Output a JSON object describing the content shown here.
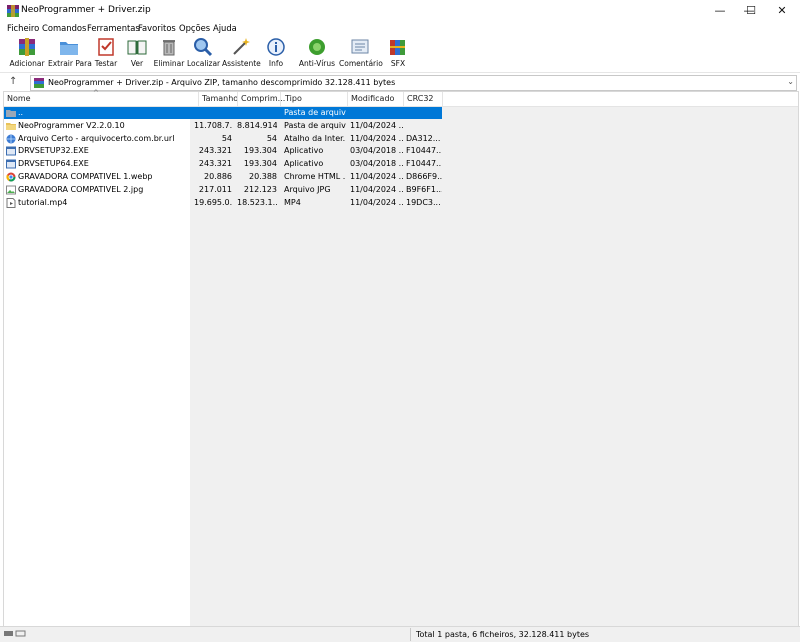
{
  "window": {
    "title": "NeoProgrammer + Driver.zip",
    "minimize": "—",
    "maximize": "☐",
    "close": "✕"
  },
  "menu": [
    "Ficheiro",
    "Comandos",
    "Ferramentas",
    "Favoritos",
    "Opções",
    "Ajuda"
  ],
  "toolbar": [
    {
      "label": "Adicionar",
      "icon": "add-archive-icon"
    },
    {
      "label": "Extrair Para",
      "icon": "extract-folder-icon"
    },
    {
      "label": "Testar",
      "icon": "test-checklist-icon"
    },
    {
      "label": "Ver",
      "icon": "view-book-icon"
    },
    {
      "label": "Eliminar",
      "icon": "trash-icon"
    },
    {
      "label": "Localizar",
      "icon": "magnifier-icon"
    },
    {
      "label": "Assistente",
      "icon": "wizard-wand-icon"
    },
    {
      "label": "Info",
      "icon": "info-icon"
    },
    {
      "label": "Anti-Vírus",
      "icon": "antivirus-bug-icon"
    },
    {
      "label": "Comentário",
      "icon": "comment-icon"
    },
    {
      "label": "SFX",
      "icon": "sfx-books-icon"
    }
  ],
  "address": {
    "up": "↑",
    "text": "NeoProgrammer + Driver.zip - Arquivo ZIP, tamanho descomprimido 32.128.411 bytes",
    "dropdown": "⌄"
  },
  "columns": {
    "name": "Nome",
    "size": "Tamanho",
    "packed": "Comprim...",
    "type": "Tipo",
    "modified": "Modificado",
    "crc": "CRC32",
    "sort_arrow": "^"
  },
  "rows": [
    {
      "name": "..",
      "size": "",
      "packed": "",
      "type": "Pasta de arquivos",
      "modified": "",
      "crc": "",
      "icon": "parent-folder-icon",
      "selected": true
    },
    {
      "name": "NeoProgrammer V2.2.0.10",
      "size": "11.708.7...",
      "packed": "8.814.914",
      "type": "Pasta de arquivos",
      "modified": "11/04/2024 ...",
      "crc": "",
      "icon": "folder-icon",
      "selected": false
    },
    {
      "name": "Arquivo Certo - arquivocerto.com.br.url",
      "size": "54",
      "packed": "54",
      "type": "Atalho da Inter...",
      "modified": "11/04/2024 ...",
      "crc": "DA312...",
      "icon": "url-shortcut-icon",
      "selected": false
    },
    {
      "name": "DRVSETUP32.EXE",
      "size": "243.321",
      "packed": "193.304",
      "type": "Aplicativo",
      "modified": "03/04/2018 ...",
      "crc": "F10447...",
      "icon": "exe-icon",
      "selected": false
    },
    {
      "name": "DRVSETUP64.EXE",
      "size": "243.321",
      "packed": "193.304",
      "type": "Aplicativo",
      "modified": "03/04/2018 ...",
      "crc": "F10447...",
      "icon": "exe-icon",
      "selected": false
    },
    {
      "name": "GRAVADORA COMPATIVEL 1.webp",
      "size": "20.886",
      "packed": "20.388",
      "type": "Chrome HTML ...",
      "modified": "11/04/2024 ...",
      "crc": "D866F9...",
      "icon": "chrome-icon",
      "selected": false
    },
    {
      "name": "GRAVADORA COMPATIVEL 2.jpg",
      "size": "217.011",
      "packed": "212.123",
      "type": "Arquivo JPG",
      "modified": "11/04/2024 ...",
      "crc": "B9F6F1...",
      "icon": "image-file-icon",
      "selected": false
    },
    {
      "name": "tutorial.mp4",
      "size": "19.695.0...",
      "packed": "18.523.1...",
      "type": "MP4",
      "modified": "11/04/2024 ...",
      "crc": "19DC3...",
      "icon": "video-file-icon",
      "selected": false
    }
  ],
  "status": {
    "text": "Total 1 pasta, 6 ficheiros, 32.128.411 bytes"
  },
  "colors": {
    "selection": "#0078d7",
    "gutter": "#f0f0f0"
  }
}
